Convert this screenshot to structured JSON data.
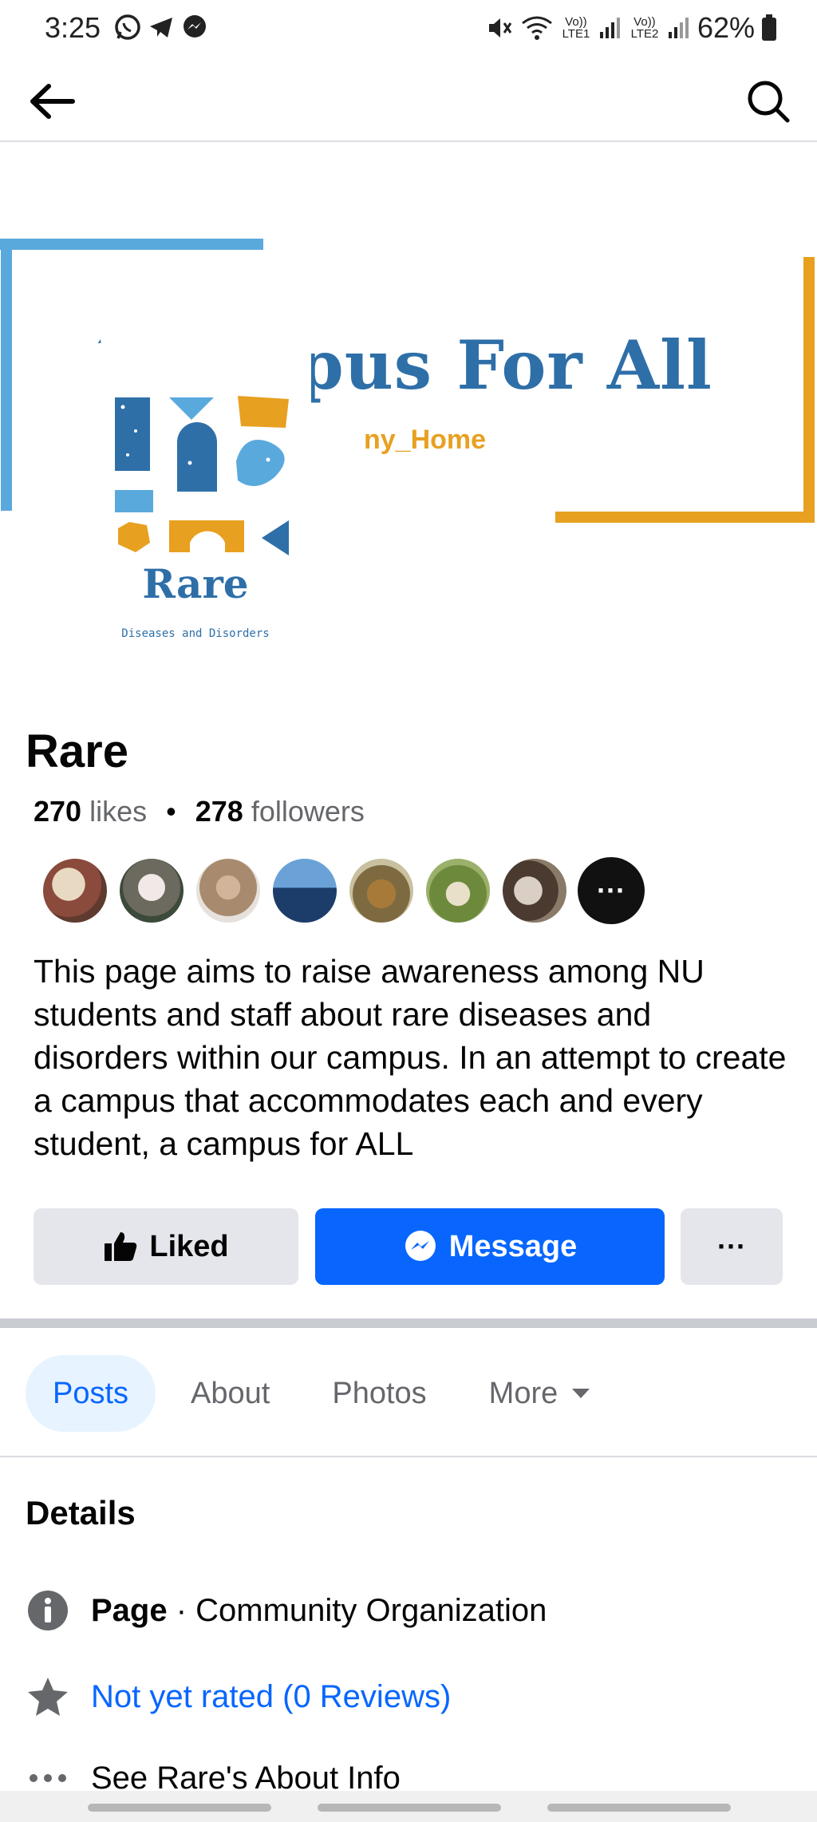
{
  "status_bar": {
    "time": "3:25",
    "signal_1": "Vo)) LTE1",
    "signal_2": "Vo)) LTE2",
    "battery": "62%"
  },
  "cover": {
    "title_visible": "pus For All",
    "subtitle_visible": "ny_Home"
  },
  "logo": {
    "name": "Rare",
    "subtitle": "Diseases and Disorders"
  },
  "page": {
    "name": "Rare",
    "likes_count": "270",
    "likes_label": "likes",
    "separator": "•",
    "followers_count": "278",
    "followers_label": "followers",
    "description": "This page aims to raise awareness among NU students and staff about rare diseases and disorders within our campus. In an attempt to create a campus that accommodates each and every student, a campus for ALL"
  },
  "friend_avatars_more": "···",
  "actions": {
    "liked_label": "Liked",
    "message_label": "Message",
    "more_label": "···"
  },
  "tabs": [
    {
      "label": "Posts",
      "active": true
    },
    {
      "label": "About",
      "active": false
    },
    {
      "label": "Photos",
      "active": false
    },
    {
      "label": "More",
      "active": false
    }
  ],
  "details": {
    "title": "Details",
    "page_type_bold": "Page",
    "page_type_rest": " · Community Organization",
    "rating": "Not yet rated (0 Reviews)",
    "about_link": "See Rare's About Info"
  },
  "colors": {
    "brand_blue": "#0866ff",
    "cover_blue": "#2e6fa8",
    "cover_orange": "#e8a020",
    "frame_light_blue": "#5aa9dd"
  }
}
